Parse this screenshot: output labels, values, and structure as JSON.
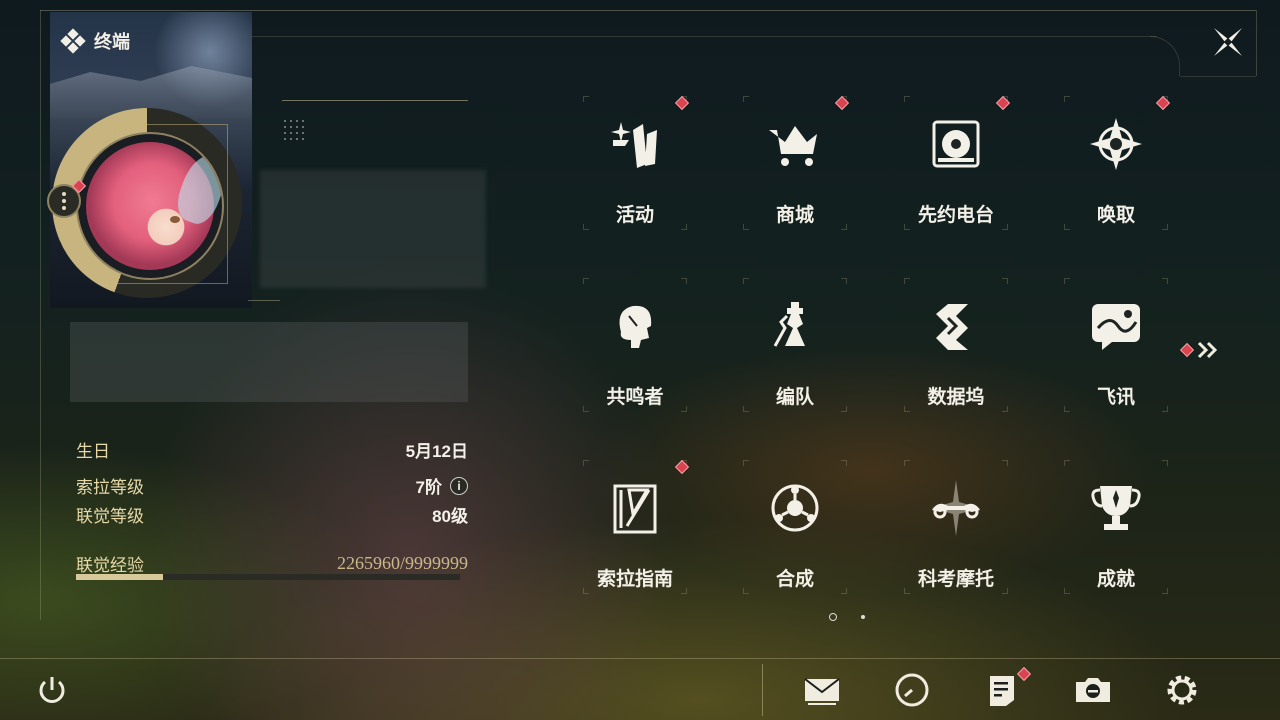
{
  "header": {
    "title": "终端"
  },
  "profile": {
    "stats": [
      {
        "label": "生日",
        "value": "5月12日"
      },
      {
        "label": "索拉等级",
        "value": "7阶"
      },
      {
        "label": "联觉等级",
        "value": "80级"
      }
    ],
    "exp": {
      "label": "联觉经验",
      "value": "2265960/9999999",
      "progress": 0.2266
    }
  },
  "menu": {
    "tiles": [
      {
        "label": "活动",
        "icon": "activity-icon",
        "badge": true
      },
      {
        "label": "商城",
        "icon": "shop-cart-icon",
        "badge": true
      },
      {
        "label": "先约电台",
        "icon": "radio-icon",
        "badge": true
      },
      {
        "label": "唤取",
        "icon": "summon-compass-icon",
        "badge": true
      },
      {
        "label": "共鸣者",
        "icon": "resonator-head-icon",
        "badge": false
      },
      {
        "label": "编队",
        "icon": "team-chess-icon",
        "badge": false
      },
      {
        "label": "数据坞",
        "icon": "data-dock-icon",
        "badge": false
      },
      {
        "label": "飞讯",
        "icon": "message-icon",
        "badge": false
      },
      {
        "label": "索拉指南",
        "icon": "guide-book-icon",
        "badge": true
      },
      {
        "label": "合成",
        "icon": "synthesis-icon",
        "badge": false
      },
      {
        "label": "科考摩托",
        "icon": "motorcycle-icon",
        "badge": false
      },
      {
        "label": "成就",
        "icon": "trophy-icon",
        "badge": false
      }
    ]
  },
  "bottom_bar": {
    "items": [
      {
        "icon": "power-icon"
      },
      {
        "icon": "mail-icon"
      },
      {
        "icon": "clock-icon"
      },
      {
        "icon": "notice-icon",
        "badge": true
      },
      {
        "icon": "camera-icon"
      },
      {
        "icon": "settings-gear-icon"
      }
    ]
  },
  "colors": {
    "accent": "#c9b98a",
    "badge": "#d94450",
    "text": "#f3f0e8"
  }
}
